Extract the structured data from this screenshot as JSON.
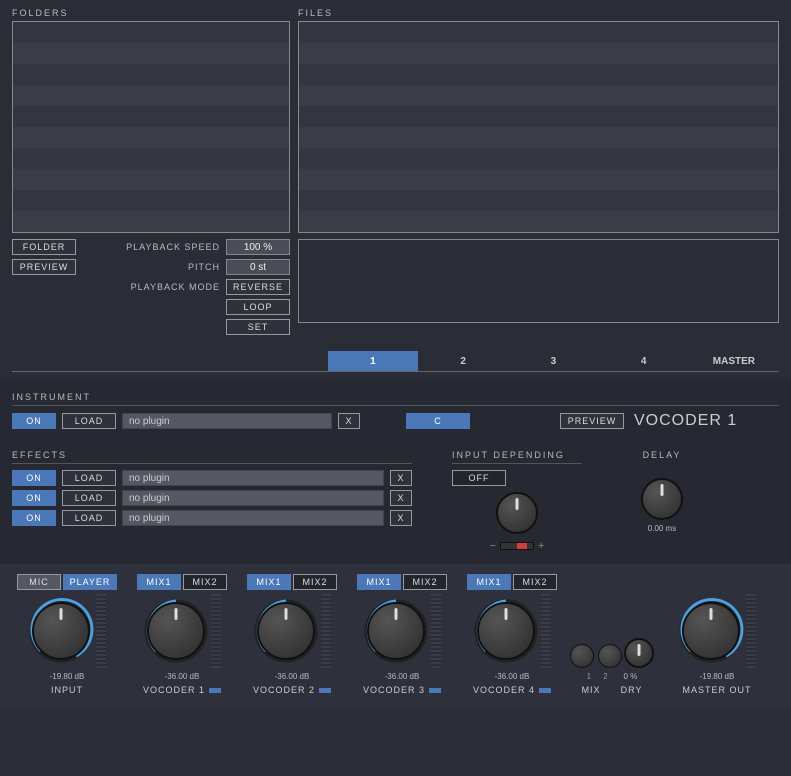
{
  "top": {
    "folders_label": "FOLDERS",
    "files_label": "FILES"
  },
  "buttons": {
    "folder": "FOLDER",
    "preview": "PREVIEW",
    "reverse": "REVERSE",
    "loop": "LOOP",
    "set": "SET",
    "on": "ON",
    "load": "LOAD",
    "x": "X",
    "off": "OFF",
    "mic": "MIC",
    "player": "PLAYER",
    "mix1": "MIX1",
    "mix2": "MIX2"
  },
  "labels": {
    "playback_speed": "PLAYBACK SPEED",
    "pitch": "PITCH",
    "playback_mode": "PLAYBACK  MODE",
    "instrument": "INSTRUMENT",
    "effects": "EFFECTS",
    "input_depending": "INPUT DEPENDING",
    "delay": "DELAY",
    "input": "INPUT",
    "master_out": "MASTER OUT",
    "mix": "MIX",
    "dry": "DRY"
  },
  "values": {
    "speed": "100 %",
    "pitch": "0 st",
    "no_plugin": "no plugin",
    "rootnote": "C",
    "delay_ms": "0.00 ms",
    "dry_pct": "0 %"
  },
  "tabs": [
    "1",
    "2",
    "3",
    "4",
    "MASTER"
  ],
  "title": "VOCODER 1",
  "mix_nums": [
    "1",
    "2"
  ],
  "channels": {
    "input": {
      "db": "-19.80 dB",
      "name": "INPUT"
    },
    "voc1": {
      "db": "-36.00 dB",
      "name": "VOCODER 1"
    },
    "voc2": {
      "db": "-36.00 dB",
      "name": "VOCODER 2"
    },
    "voc3": {
      "db": "-36.00 dB",
      "name": "VOCODER 3"
    },
    "voc4": {
      "db": "-36.00 dB",
      "name": "VOCODER 4"
    },
    "master": {
      "db": "-19.80 dB",
      "name": "MASTER OUT"
    }
  }
}
